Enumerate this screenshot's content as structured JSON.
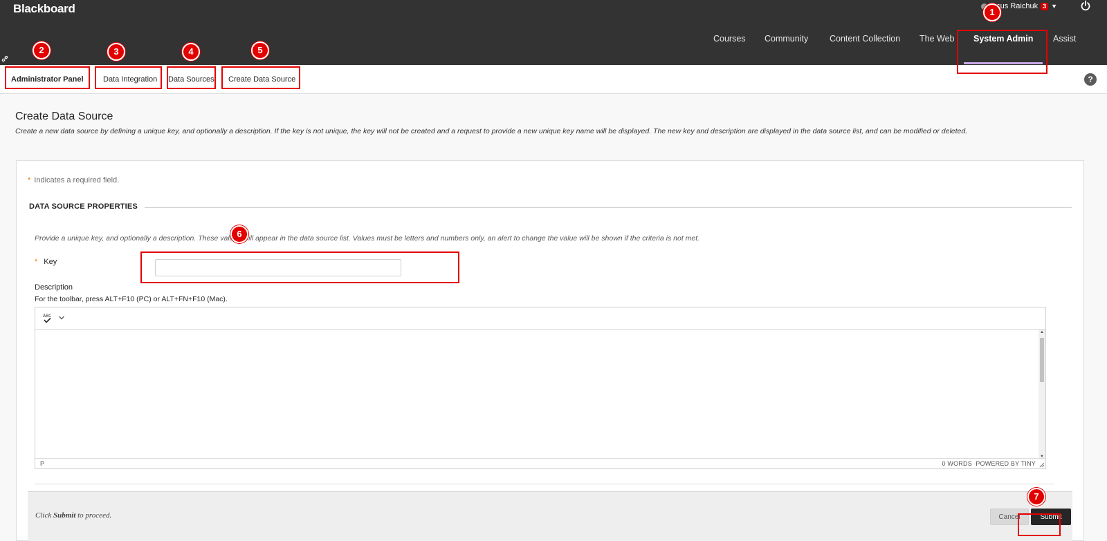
{
  "app": {
    "logo": "Blackboard"
  },
  "user": {
    "name": "Iesus Raichuk",
    "notifications": "3",
    "caret": "▼"
  },
  "nav": {
    "items": [
      {
        "label": "Courses"
      },
      {
        "label": "Community"
      },
      {
        "label": "Content Collection"
      },
      {
        "label": "The Web"
      },
      {
        "label": "System Admin",
        "active": true
      },
      {
        "label": "Assist"
      }
    ]
  },
  "breadcrumb": {
    "items": [
      "Administrator Panel",
      "Data Integration",
      "Data Sources",
      "Create Data Source"
    ],
    "help": "?"
  },
  "page": {
    "title": "Create Data Source",
    "description": "Create a new data source by defining a unique key, and optionally a description. If the key is not unique, the key will not be created and a request to provide a new unique key name will be displayed. The new key and description are displayed in the data source list, and can be modified or deleted."
  },
  "form": {
    "required_star": "*",
    "required_note": "Indicates a required field.",
    "section_title": "DATA SOURCE PROPERTIES",
    "instructions": "Provide a unique key, and optionally a description. These values will appear in the data source list. Values must be letters and numbers only, an alert to change the value will be shown if the criteria is not met.",
    "key_label": "Key",
    "key_value": "",
    "description_label": "Description",
    "toolbar_hint": "For the toolbar, press ALT+F10 (PC) or ALT+FN+F10 (Mac).",
    "editor": {
      "status_path": "P",
      "word_count": "0 WORDS",
      "powered_by": "POWERED BY TINY"
    }
  },
  "submit_bar": {
    "prefix": "Click",
    "action": "Submit",
    "suffix": "to proceed.",
    "cancel_label": "Cancel",
    "submit_label": "Submit"
  },
  "annotations": {
    "accent": "#e30000",
    "markers": [
      "1",
      "2",
      "3",
      "4",
      "5",
      "6",
      "7"
    ]
  }
}
